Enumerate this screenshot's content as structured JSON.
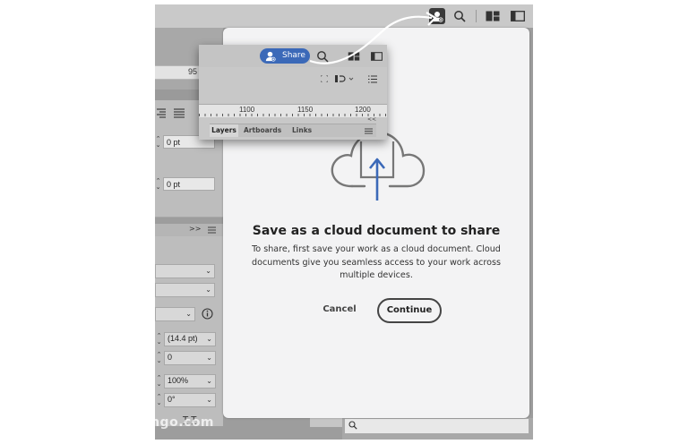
{
  "toolbar": {
    "icons": [
      "share-account-icon",
      "search-icon",
      "arrange-panels-icon",
      "panel-toggle-icon"
    ]
  },
  "left_panel": {
    "ruler_tick": "95",
    "collapse_label": ">>",
    "field_1": "0 pt",
    "field_2": "0 pt",
    "panel2_collapse": ">>",
    "leading": "(14.4 pt)",
    "tracking": "0",
    "scale": "100%",
    "rotation": "0°"
  },
  "inset": {
    "share_label": "Share",
    "ruler": [
      "1100",
      "1150",
      "1200"
    ],
    "tabs": [
      "Layers",
      "Artboards",
      "Links"
    ],
    "collapse_label": "<<"
  },
  "dialog": {
    "title": "Save as a cloud document to share",
    "body": "To share, first save your work as a cloud document. Cloud documents give you seamless access to your work across multiple devices.",
    "cancel_label": "Cancel",
    "continue_label": "Continue",
    "accent_color": "#3b69b8"
  },
  "watermark": "ColorMango.com"
}
